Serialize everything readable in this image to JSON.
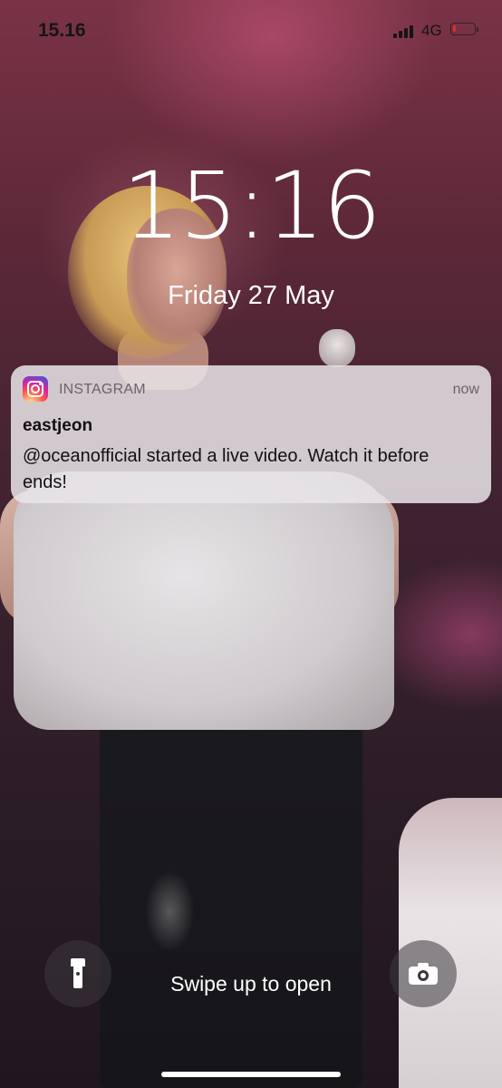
{
  "status_bar": {
    "time": "15.16",
    "network": "4G",
    "signal_bars": 4,
    "battery_level": 0.15,
    "battery_color": "#e0302a"
  },
  "lock_screen": {
    "time": "15:16",
    "date": "Friday 27 May"
  },
  "notification": {
    "app_name": "INSTAGRAM",
    "app_icon": "instagram-icon",
    "time": "now",
    "title": "eastjeon",
    "body": "@oceanofficial started a live video. Watch it before ends!"
  },
  "bottom": {
    "swipe_hint": "Swipe up to open",
    "left_button_icon": "flashlight-icon",
    "right_button_icon": "camera-icon"
  }
}
